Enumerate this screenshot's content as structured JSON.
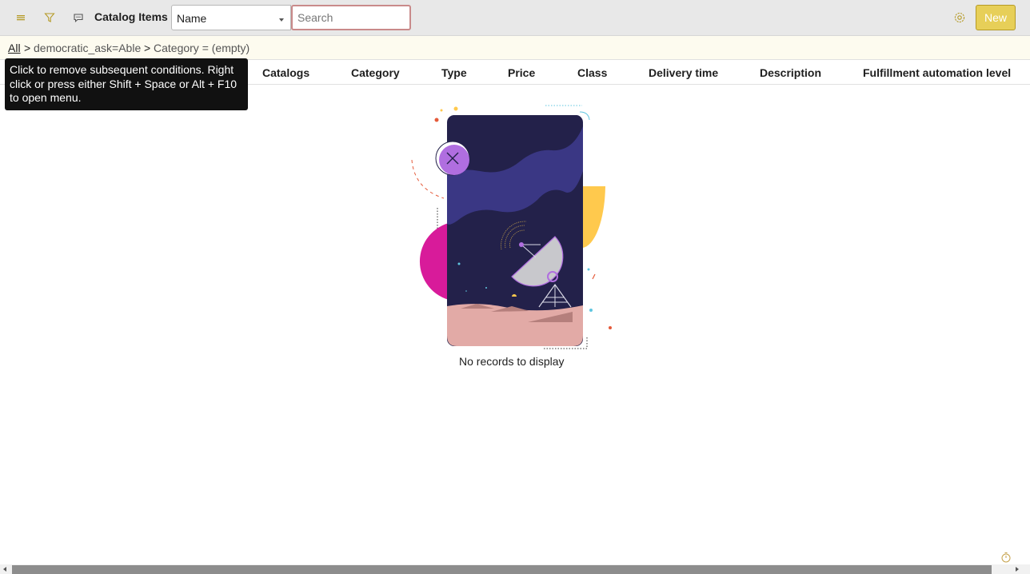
{
  "header": {
    "title": "Catalog Items",
    "select_value": "Name",
    "search_placeholder": "Search",
    "new_label": "New"
  },
  "breadcrumb": {
    "all": "All",
    "separator": ">",
    "condition_1": "democratic_ask=Able",
    "condition_2": "Category = (empty)"
  },
  "columns": [
    "Catalogs",
    "Category",
    "Type",
    "Price",
    "Class",
    "Delivery time",
    "Description",
    "Fulfillment automation level"
  ],
  "tooltip": "Click to remove subsequent conditions. Right click or press either Shift + Space or Alt + F10 to open menu.",
  "empty_state": "No records to display",
  "icons": {
    "menu": "hamburger-menu-icon",
    "filter": "funnel-filter-icon",
    "chat": "chat-bubble-icon",
    "settings": "gear-icon",
    "timer": "stopwatch-icon"
  },
  "colors": {
    "accent_button": "#e7cf58",
    "icon_gold": "#b59a26",
    "search_border": "#c98a8a",
    "tooltip_bg": "#111111",
    "illus_navy": "#23214a",
    "illus_purple": "#3a3784",
    "illus_magenta": "#d81b9a",
    "illus_yellow": "#ffc94d",
    "illus_sand": "#e2aaa6",
    "illus_violet": "#b06ee0"
  }
}
